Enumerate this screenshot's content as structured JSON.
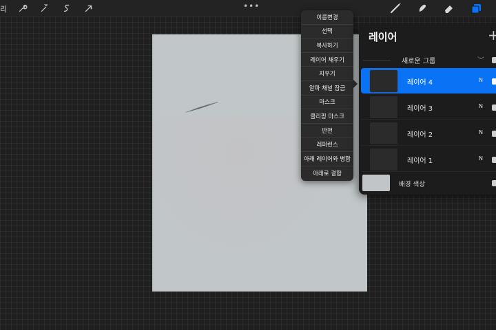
{
  "toolbar": {
    "gallery_label": "리",
    "more_label": "•••"
  },
  "context_menu": {
    "items": [
      {
        "label": "이름변경"
      },
      {
        "label": "선택"
      },
      {
        "label": "복사하기"
      },
      {
        "label": "레이어 채우기"
      },
      {
        "label": "지우기"
      },
      {
        "label": "알파 채널 잠금"
      },
      {
        "label": "마스크"
      },
      {
        "label": "클리핑 마스크"
      },
      {
        "label": "반전"
      },
      {
        "label": "레퍼런스"
      },
      {
        "label": "아래 레이어와 병합"
      },
      {
        "label": "아래로 결합"
      }
    ]
  },
  "layers_panel": {
    "title": "레이어",
    "add_label": "+",
    "group": {
      "label": "새로운 그룹",
      "chevron": "﹀"
    },
    "layers": [
      {
        "name": "레이어 4",
        "blend": "N",
        "active": true
      },
      {
        "name": "레이어 3",
        "blend": "N",
        "active": false
      },
      {
        "name": "레이어 2",
        "blend": "N",
        "active": false
      },
      {
        "name": "레이어 1",
        "blend": "N",
        "active": false
      }
    ],
    "background": {
      "label": "배경 색상",
      "color": "#c2c5c7"
    }
  },
  "colors": {
    "accent": "#0a72f5",
    "canvas": "#c1c6c8",
    "menu_bg": "#2b2b2b",
    "panel_bg": "#1c1c1c"
  },
  "icons": [
    "wrench-icon",
    "magic-wand-icon",
    "selection-s-icon",
    "transform-arrow-icon",
    "brush-icon",
    "smudge-icon",
    "eraser-icon",
    "layers-icon"
  ]
}
